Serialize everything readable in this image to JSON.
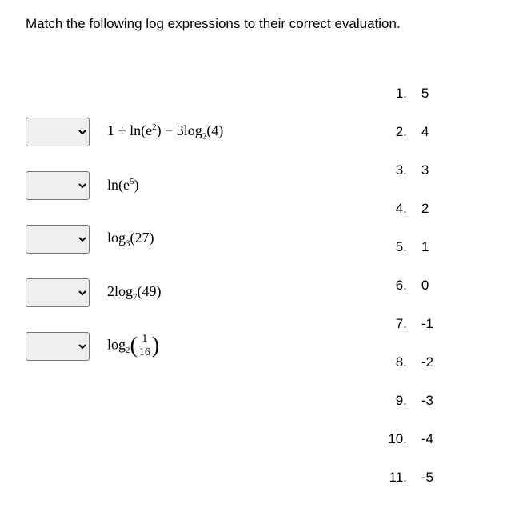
{
  "question": "Match the following log expressions to their correct evaluation.",
  "expressions": {
    "e1_a": "1 + ln",
    "e1_b": "e",
    "e1_c": "2",
    "e1_d": " − 3log",
    "e1_e": "2",
    "e1_f": "(4)",
    "e2_a": "ln",
    "e2_b": "e",
    "e2_c": "5",
    "e3_a": "log",
    "e3_b": "3",
    "e3_c": "(27)",
    "e4_a": "2log",
    "e4_b": "7",
    "e4_c": "(49)",
    "e5_a": "log",
    "e5_b": "2",
    "e5_num": "1",
    "e5_den": "16"
  },
  "answers": [
    {
      "n": "1.",
      "v": "5"
    },
    {
      "n": "2.",
      "v": "4"
    },
    {
      "n": "3.",
      "v": "3"
    },
    {
      "n": "4.",
      "v": "2"
    },
    {
      "n": "5.",
      "v": "1"
    },
    {
      "n": "6.",
      "v": "0"
    },
    {
      "n": "7.",
      "v": "-1"
    },
    {
      "n": "8.",
      "v": "-2"
    },
    {
      "n": "9.",
      "v": "-3"
    },
    {
      "n": "10.",
      "v": "-4"
    },
    {
      "n": "11.",
      "v": "-5"
    }
  ]
}
